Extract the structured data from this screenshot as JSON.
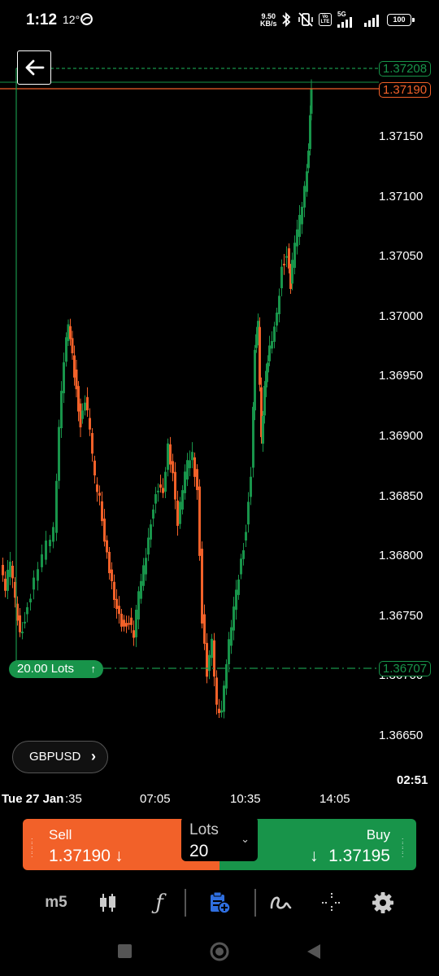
{
  "status_bar": {
    "time": "1:12",
    "temperature": "12°",
    "network_speed_value": "9.50",
    "network_speed_unit": "KB/s",
    "volte": "Vo LTE",
    "network_type": "5G",
    "battery": "100"
  },
  "chart": {
    "symbol": "GBPUSD",
    "price_axis": [
      "1.37150",
      "1.37100",
      "1.37050",
      "1.37000",
      "1.36950",
      "1.36900",
      "1.36850",
      "1.36800",
      "1.36750",
      "1.36700",
      "1.36650"
    ],
    "ask_line_price": "1.37208",
    "bid_line_price": "1.37190",
    "position_price": "1.36707",
    "position_lots": "20.00 Lots",
    "time_axis": [
      "Tue 27 Jan",
      ":35",
      "07:05",
      "10:35",
      "14:05"
    ],
    "bar_countdown": "02:51",
    "colors": {
      "bull": "#18944a",
      "bear": "#f26129",
      "ask": "#18944a",
      "bid": "#f26129"
    }
  },
  "trade_panel": {
    "sell_label": "Sell",
    "sell_price": "1.37190",
    "buy_label": "Buy",
    "buy_price": "1.37195",
    "lots_label": "Lots",
    "lots_value": "20",
    "sell_color": "#f26129",
    "buy_color": "#18944a"
  },
  "toolbar": {
    "timeframe": "m5",
    "items": [
      "timeframe",
      "chart-type-icon",
      "indicators-icon",
      "trade-clipboard-icon",
      "drawing-tools-icon",
      "crosshair-icon",
      "settings-icon"
    ]
  }
}
